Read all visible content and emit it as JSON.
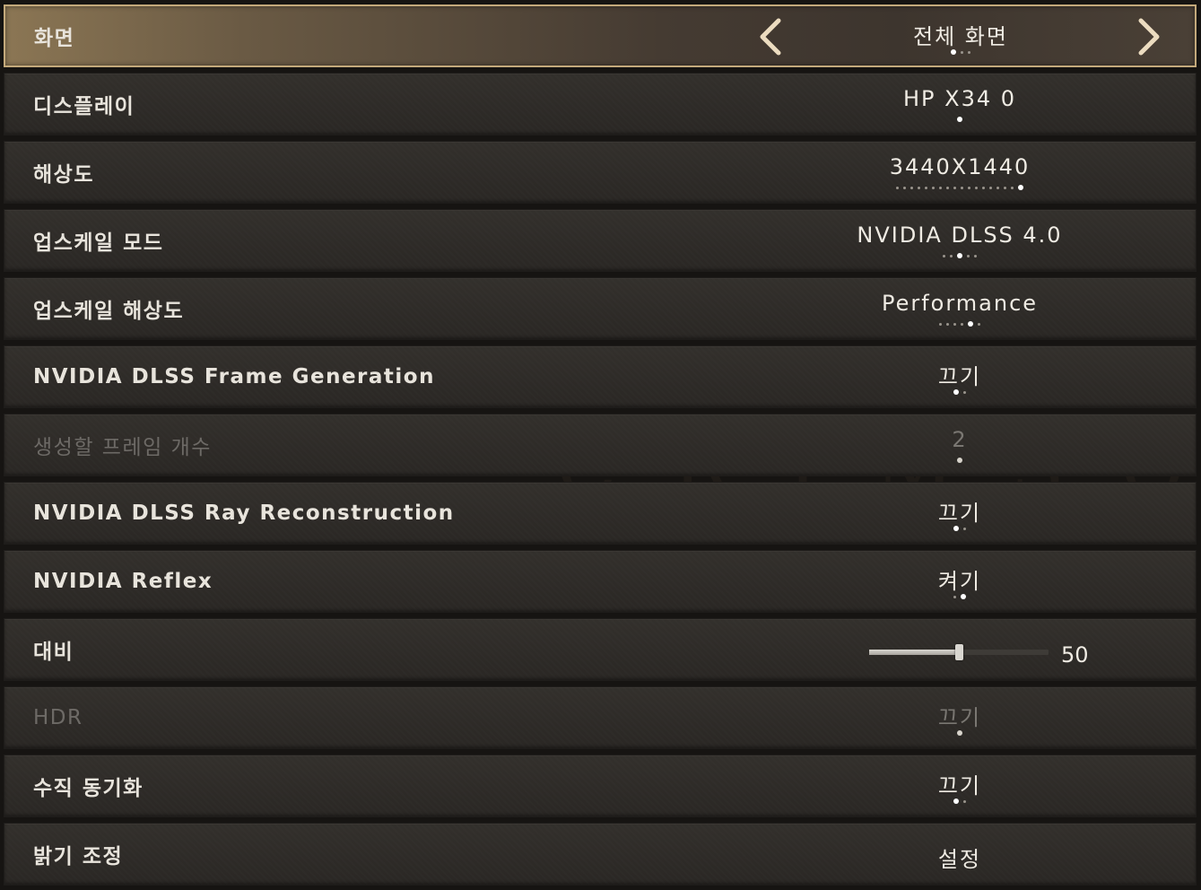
{
  "watermark": "CRIMSO",
  "rows": [
    {
      "id": "screen-mode",
      "label": "화면",
      "value": "전체 화면",
      "dots": 3,
      "active": 0,
      "selected": true,
      "arrows": true
    },
    {
      "id": "display",
      "label": "디스플레이",
      "value": "HP X34 0",
      "dots": 1,
      "active": 0
    },
    {
      "id": "resolution",
      "label": "해상도",
      "value": "3440X1440",
      "dots": 18,
      "active": 17
    },
    {
      "id": "upscale-mode",
      "label": "업스케일 모드",
      "value": "NVIDIA DLSS 4.0",
      "dots": 5,
      "active": 2
    },
    {
      "id": "upscale-resolution",
      "label": "업스케일 해상도",
      "value": "Performance",
      "dots": 6,
      "active": 4
    },
    {
      "id": "frame-generation",
      "label": "NVIDIA DLSS Frame Generation",
      "value": "끄기",
      "dots": 2,
      "active": 0
    },
    {
      "id": "frames-to-generate",
      "label": "생성할 프레임 개수",
      "value": "2",
      "dots": 1,
      "active": 0,
      "disabled": true
    },
    {
      "id": "ray-reconstruction",
      "label": "NVIDIA DLSS Ray Reconstruction",
      "value": "끄기",
      "dots": 2,
      "active": 0
    },
    {
      "id": "reflex",
      "label": "NVIDIA Reflex",
      "value": "켜기",
      "dots": 2,
      "active": 1
    },
    {
      "id": "contrast",
      "label": "대비",
      "slider": true,
      "value": "50",
      "level": 50,
      "max": 100
    },
    {
      "id": "hdr",
      "label": "HDR",
      "value": "끄기",
      "dots": 1,
      "active": 0,
      "disabled": true
    },
    {
      "id": "vsync",
      "label": "수직 동기화",
      "value": "끄기",
      "dots": 2,
      "active": 0
    },
    {
      "id": "brightness",
      "label": "밝기 조정",
      "value": "설정",
      "dots": 0,
      "active": -1
    }
  ],
  "colors": {
    "selected_border": "#c3a97b",
    "row_bg": "#2f2c28",
    "text": "#e8e4dc",
    "disabled_text": "#6d6a66"
  },
  "icons": {
    "left": "chevron-left-icon",
    "right": "chevron-right-icon"
  }
}
